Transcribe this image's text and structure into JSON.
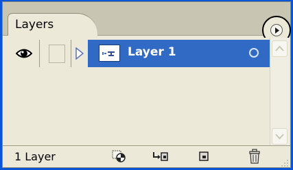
{
  "panel": {
    "tab_label": "Layers"
  },
  "icons": {
    "menu": "panel-menu-icon",
    "visibility": "eye-icon",
    "expand": "expand-triangle-icon",
    "target": "target-circle-icon",
    "new_set": "new-layer-set-icon",
    "new_set_from_linked": "new-set-from-linked-icon",
    "new_layer": "new-layer-icon",
    "delete": "trash-icon"
  },
  "layers": [
    {
      "name": "Layer 1",
      "visible": true,
      "selected": true
    }
  ],
  "footer": {
    "count_text": "1 Layer"
  },
  "colors": {
    "selection": "#316ac5",
    "panel_bg": "#ece9d8",
    "desktop": "#0a55d6"
  }
}
